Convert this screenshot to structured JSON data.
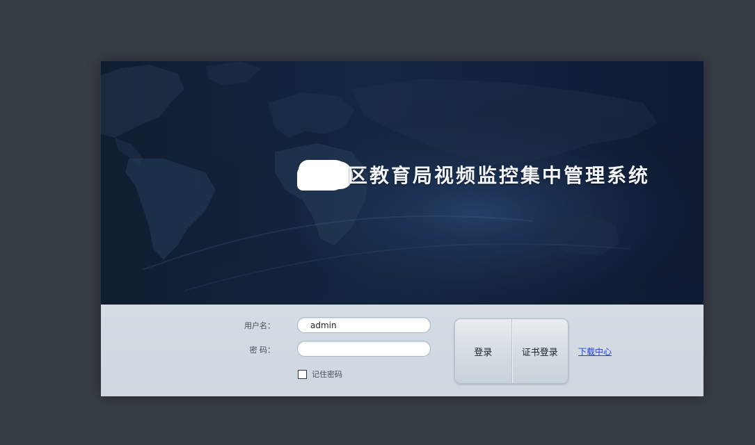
{
  "banner": {
    "title": "区教育局视频监控集中管理系统"
  },
  "login": {
    "username_label": "用户名：",
    "username_value": "admin",
    "password_label": "密 码：",
    "password_value": "",
    "remember_label": "记住密码",
    "remember_checked": false,
    "login_button": "登录",
    "cert_login_button": "证书登录",
    "download_link": "下载中心"
  },
  "colors": {
    "page_background": "#373d45",
    "banner_dark": "#11213a",
    "form_background": "#d0d9e1",
    "link": "#1f3fd0"
  }
}
